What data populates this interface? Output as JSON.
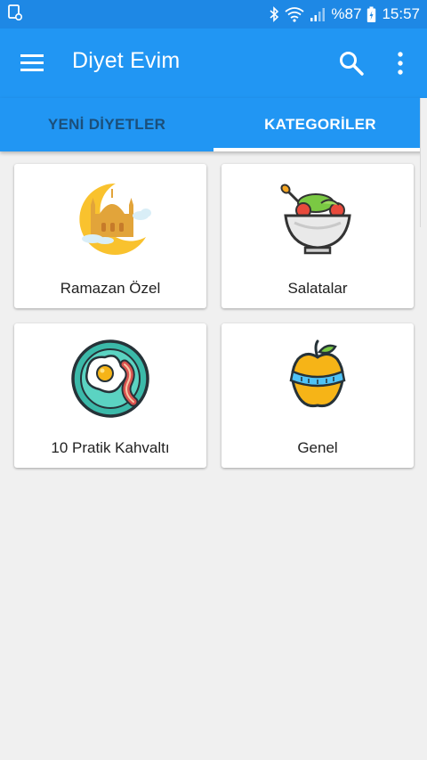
{
  "status_bar": {
    "battery_percent": "%87",
    "time": "15:57",
    "icons": [
      "notification-icon",
      "bluetooth-icon",
      "wifi-icon",
      "signal-icon",
      "battery-icon"
    ]
  },
  "app_bar": {
    "title": "Diyet Evim",
    "color": "#2196f3",
    "icons": [
      "menu-icon",
      "search-icon",
      "more-vert-icon"
    ]
  },
  "tabs": [
    {
      "label": "YENİ DİYETLER",
      "selected": false
    },
    {
      "label": "KATEGORİLER",
      "selected": true
    }
  ],
  "categories": [
    {
      "label": "Ramazan Özel",
      "icon": "ramadan-mosque-icon"
    },
    {
      "label": "Salatalar",
      "icon": "salad-bowl-icon"
    },
    {
      "label": "10 Pratik Kahvaltı",
      "icon": "breakfast-egg-bacon-icon"
    },
    {
      "label": "Genel",
      "icon": "apple-measuring-tape-icon"
    }
  ]
}
